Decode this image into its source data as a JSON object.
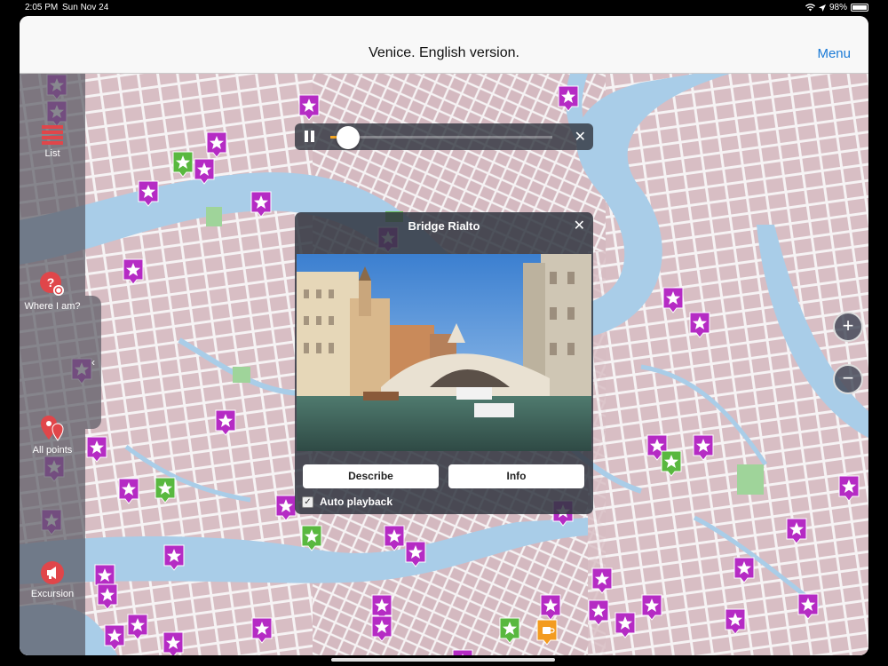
{
  "status": {
    "time": "2:05 PM",
    "date": "Sun Nov 24",
    "battery": "98%"
  },
  "navbar": {
    "title": "Venice. English version.",
    "menu": "Menu"
  },
  "sidebar": {
    "items": [
      {
        "label": "List",
        "icon": "list-icon"
      },
      {
        "label": "Where I am?",
        "icon": "location-question-icon"
      },
      {
        "label": "All points",
        "icon": "all-points-icon"
      },
      {
        "label": "Excursion",
        "icon": "megaphone-icon"
      }
    ],
    "handle": "‹"
  },
  "player": {
    "progress": 0.04,
    "close": "✕"
  },
  "popup": {
    "title": "Bridge Rialto",
    "close": "✕",
    "describe": "Describe",
    "info": "Info",
    "auto_label": "Auto playback",
    "auto_checked": "✓"
  },
  "zoom": {
    "in": "+",
    "out": "−"
  },
  "colors": {
    "poi": "#b52bc4",
    "green": "#59b83f",
    "orange": "#f39b1f",
    "canal": "#a9cde8"
  }
}
